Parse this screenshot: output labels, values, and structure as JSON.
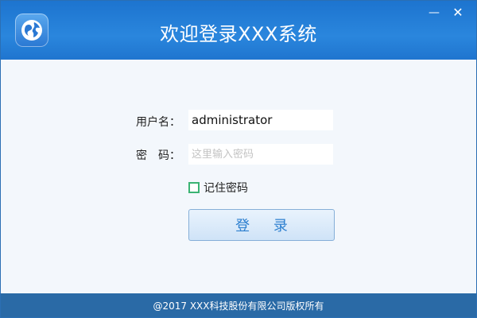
{
  "window": {
    "title": "欢迎登录XXX系统",
    "minimize_glyph": "—",
    "close_glyph": "✕",
    "logo_icon": "globe-icon"
  },
  "form": {
    "username_label": "用户名：",
    "username_value": "administrator",
    "password_label": "密　码：",
    "password_placeholder": "这里输入密码",
    "remember_label": "记住密码",
    "remember_checked": false,
    "login_label": "登 录"
  },
  "footer": {
    "copyright": "@2017 XXX科技股份有限公司版权所有"
  },
  "colors": {
    "titlebar": "#1d74cf",
    "footer": "#2a6aa6",
    "accent": "#2c7fcf",
    "checkbox_border": "#3ab373"
  }
}
